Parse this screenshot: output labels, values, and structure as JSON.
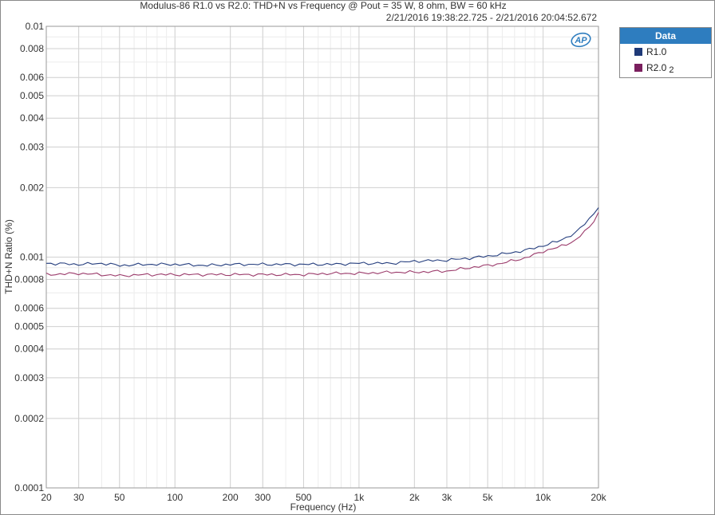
{
  "chart_data": {
    "type": "line",
    "title": "Modulus-86 R1.0 vs R2.0: THD+N vs Frequency @ Pout = 35 W, 8 ohm, BW = 60 kHz",
    "subtitle": "2/21/2016 19:38:22.725 - 2/21/2016 20:04:52.672",
    "xlabel": "Frequency (Hz)",
    "ylabel": "THD+N Ratio (%)",
    "xscale": "log",
    "yscale": "log",
    "xlim": [
      20,
      20000
    ],
    "ylim": [
      0.0001,
      0.01
    ],
    "x_ticks": [
      20,
      30,
      50,
      100,
      200,
      300,
      500,
      1000,
      2000,
      3000,
      5000,
      10000,
      20000
    ],
    "x_tick_labels": [
      "20",
      "30",
      "50",
      "100",
      "200",
      "300",
      "500",
      "1k",
      "2k",
      "3k",
      "5k",
      "10k",
      "20k"
    ],
    "y_ticks": [
      0.0001,
      0.0002,
      0.0003,
      0.0004,
      0.0005,
      0.0006,
      0.0008,
      0.001,
      0.002,
      0.003,
      0.004,
      0.005,
      0.006,
      0.008,
      0.01
    ],
    "y_tick_labels": [
      "0.0001",
      "0.0002",
      "0.0003",
      "0.0004",
      "0.0005",
      "0.0006",
      "0.0008",
      "0.001",
      "0.002",
      "0.003",
      "0.004",
      "0.005",
      "0.006",
      "0.008",
      "0.01"
    ],
    "grid": true,
    "legend_position": "right-top",
    "series": [
      {
        "name": "R1.0",
        "color": "#253e7e",
        "x": [
          20,
          30,
          40,
          50,
          70,
          100,
          150,
          200,
          300,
          500,
          700,
          1000,
          1500,
          2000,
          3000,
          4000,
          5000,
          6000,
          7000,
          8000,
          10000,
          12000,
          15000,
          18000,
          20000
        ],
        "y": [
          0.00094,
          0.00093,
          0.00094,
          0.00092,
          0.00093,
          0.00093,
          0.00092,
          0.00093,
          0.00093,
          0.00093,
          0.00093,
          0.00094,
          0.00094,
          0.00096,
          0.00097,
          0.00099,
          0.00101,
          0.00103,
          0.00105,
          0.00107,
          0.00112,
          0.00117,
          0.00127,
          0.00148,
          0.00164
        ]
      },
      {
        "name": "R2.0",
        "color": "#9b3b6b",
        "x": [
          20,
          30,
          40,
          50,
          70,
          100,
          150,
          200,
          300,
          500,
          700,
          1000,
          1500,
          2000,
          3000,
          4000,
          5000,
          6000,
          7000,
          8000,
          10000,
          12000,
          15000,
          18000,
          20000
        ],
        "y": [
          0.00084,
          0.00085,
          0.00084,
          0.00083,
          0.00084,
          0.00084,
          0.00084,
          0.00084,
          0.00084,
          0.00084,
          0.00085,
          0.00085,
          0.00086,
          0.00086,
          0.00087,
          0.0009,
          0.00092,
          0.00094,
          0.00097,
          0.00099,
          0.00106,
          0.0011,
          0.00118,
          0.00136,
          0.00155
        ]
      }
    ]
  },
  "legend": {
    "header": "Data",
    "items": [
      {
        "label": "R1.0",
        "index": "",
        "color": "#1f3a78"
      },
      {
        "label": "R2.0",
        "index": "2",
        "color": "#7a1f5e"
      }
    ]
  },
  "logo_text": "AP"
}
